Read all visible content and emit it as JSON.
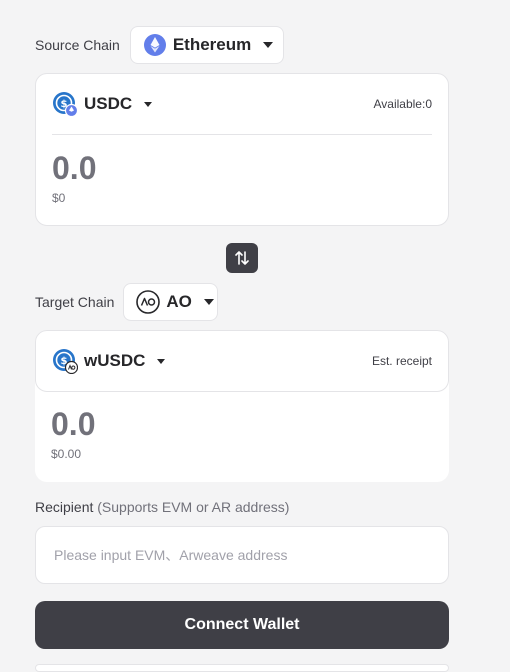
{
  "source": {
    "label": "Source Chain",
    "chain": "Ethereum",
    "token": "USDC",
    "balance_note": "Available:0",
    "amount": "0.0",
    "fiat": "$0"
  },
  "swap": {
    "icon": "swap-vertical-icon"
  },
  "target": {
    "label": "Target Chain",
    "chain": "AO",
    "token": "wUSDC",
    "note": "Est. receipt",
    "amount": "0.0",
    "fiat": "$0.00"
  },
  "recipient": {
    "label": "Recipient",
    "sub_label": "(Supports EVM or AR address)",
    "placeholder": "Please input EVM、Arweave address",
    "value": ""
  },
  "action": {
    "connect_label": "Connect Wallet"
  },
  "colors": {
    "ethereum": "#627eea",
    "usdc": "#2775ca",
    "button_dark": "#3f3f46",
    "text_muted": "#71717a"
  }
}
